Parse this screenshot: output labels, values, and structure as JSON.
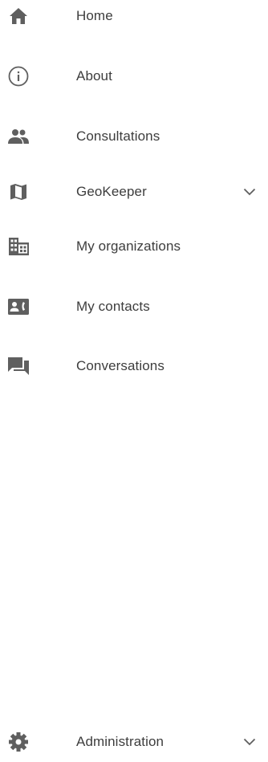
{
  "nav": {
    "items": [
      {
        "label": "Home",
        "icon": "home-icon"
      },
      {
        "label": "About",
        "icon": "info-icon"
      },
      {
        "label": "Consultations",
        "icon": "people-icon"
      },
      {
        "label": "GeoKeeper",
        "icon": "map-icon",
        "expandable": true
      },
      {
        "label": "My organizations",
        "icon": "building-icon"
      },
      {
        "label": "My contacts",
        "icon": "contact-card-icon"
      },
      {
        "label": "Conversations",
        "icon": "chat-icon"
      }
    ],
    "footer": {
      "label": "Administration",
      "icon": "gear-icon",
      "expandable": true
    }
  },
  "colors": {
    "icon": "#5f5f5f",
    "text": "#3d3d3d",
    "background": "#ffffff"
  }
}
